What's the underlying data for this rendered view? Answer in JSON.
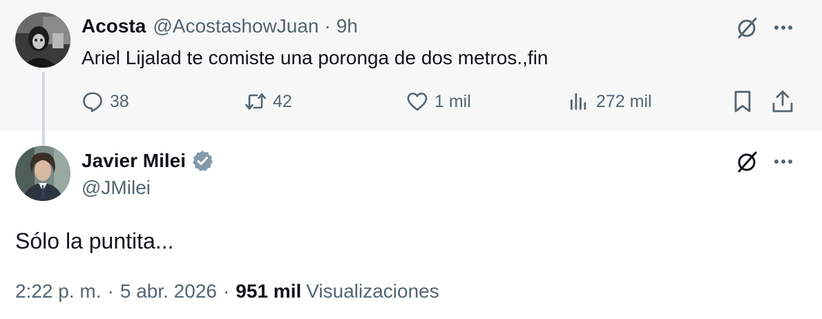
{
  "parent_tweet": {
    "name": "Acosta",
    "handle": "@AcostashowJuan",
    "separator": "·",
    "time": "9h",
    "text": "Ariel Lijalad te comiste una poronga de dos metros.,fin",
    "avatar_icon": "grayscale-photo-avatar",
    "actions": {
      "replies": "38",
      "retweets": "42",
      "likes": "1 mil",
      "views": "272 mil"
    }
  },
  "main_tweet": {
    "name": "Javier Milei",
    "verified": true,
    "verified_color": "#829aab",
    "handle": "@JMilei",
    "avatar_icon": "photo-avatar-suit",
    "text": "Sólo la puntita...",
    "meta": {
      "time": "2:22 p. m.",
      "separator": "·",
      "date": "5 abr. 2026",
      "views_count": "951 mil",
      "views_label": "Visualizaciones"
    }
  },
  "colors": {
    "parent_background": "#f7f7f7",
    "text_primary": "#0f1419",
    "text_secondary": "#536471",
    "thread_line": "#cfd9de"
  }
}
